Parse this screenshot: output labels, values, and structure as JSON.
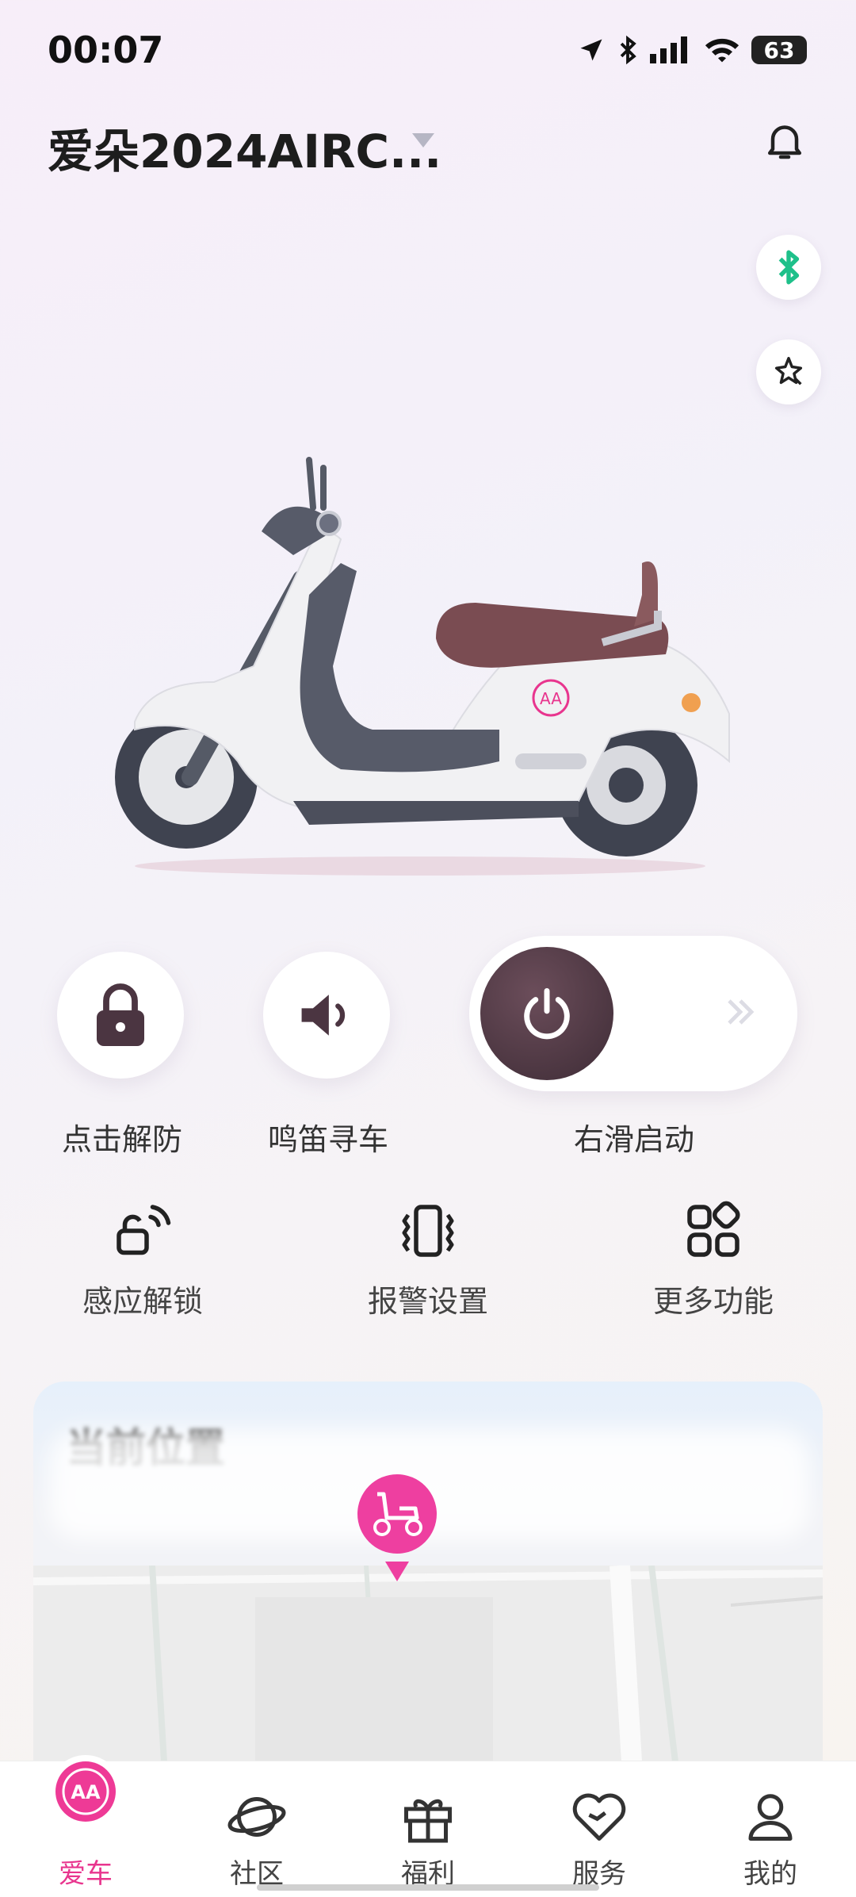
{
  "status_bar": {
    "time": "00:07",
    "battery": "63"
  },
  "header": {
    "vehicle_name": "爱朵2024AIRC..."
  },
  "controls": {
    "unlock_label": "点击解防",
    "horn_label": "鸣笛寻车",
    "start_label": "右滑启动"
  },
  "functions": [
    {
      "label": "感应解锁",
      "icon": "proximity-unlock-icon"
    },
    {
      "label": "报警设置",
      "icon": "vibration-alarm-icon"
    },
    {
      "label": "更多功能",
      "icon": "more-grid-icon"
    }
  ],
  "location_card": {
    "title": "当前位置"
  },
  "tabs": [
    {
      "label": "爱车",
      "icon": "brand-logo-icon",
      "active": true
    },
    {
      "label": "社区",
      "icon": "planet-icon"
    },
    {
      "label": "福利",
      "icon": "gift-icon"
    },
    {
      "label": "服务",
      "icon": "heart-icon"
    },
    {
      "label": "我的",
      "icon": "user-icon"
    }
  ],
  "colors": {
    "accent": "#e8358e",
    "bluetooth": "#1ec08a",
    "knob": "#4b3541"
  }
}
